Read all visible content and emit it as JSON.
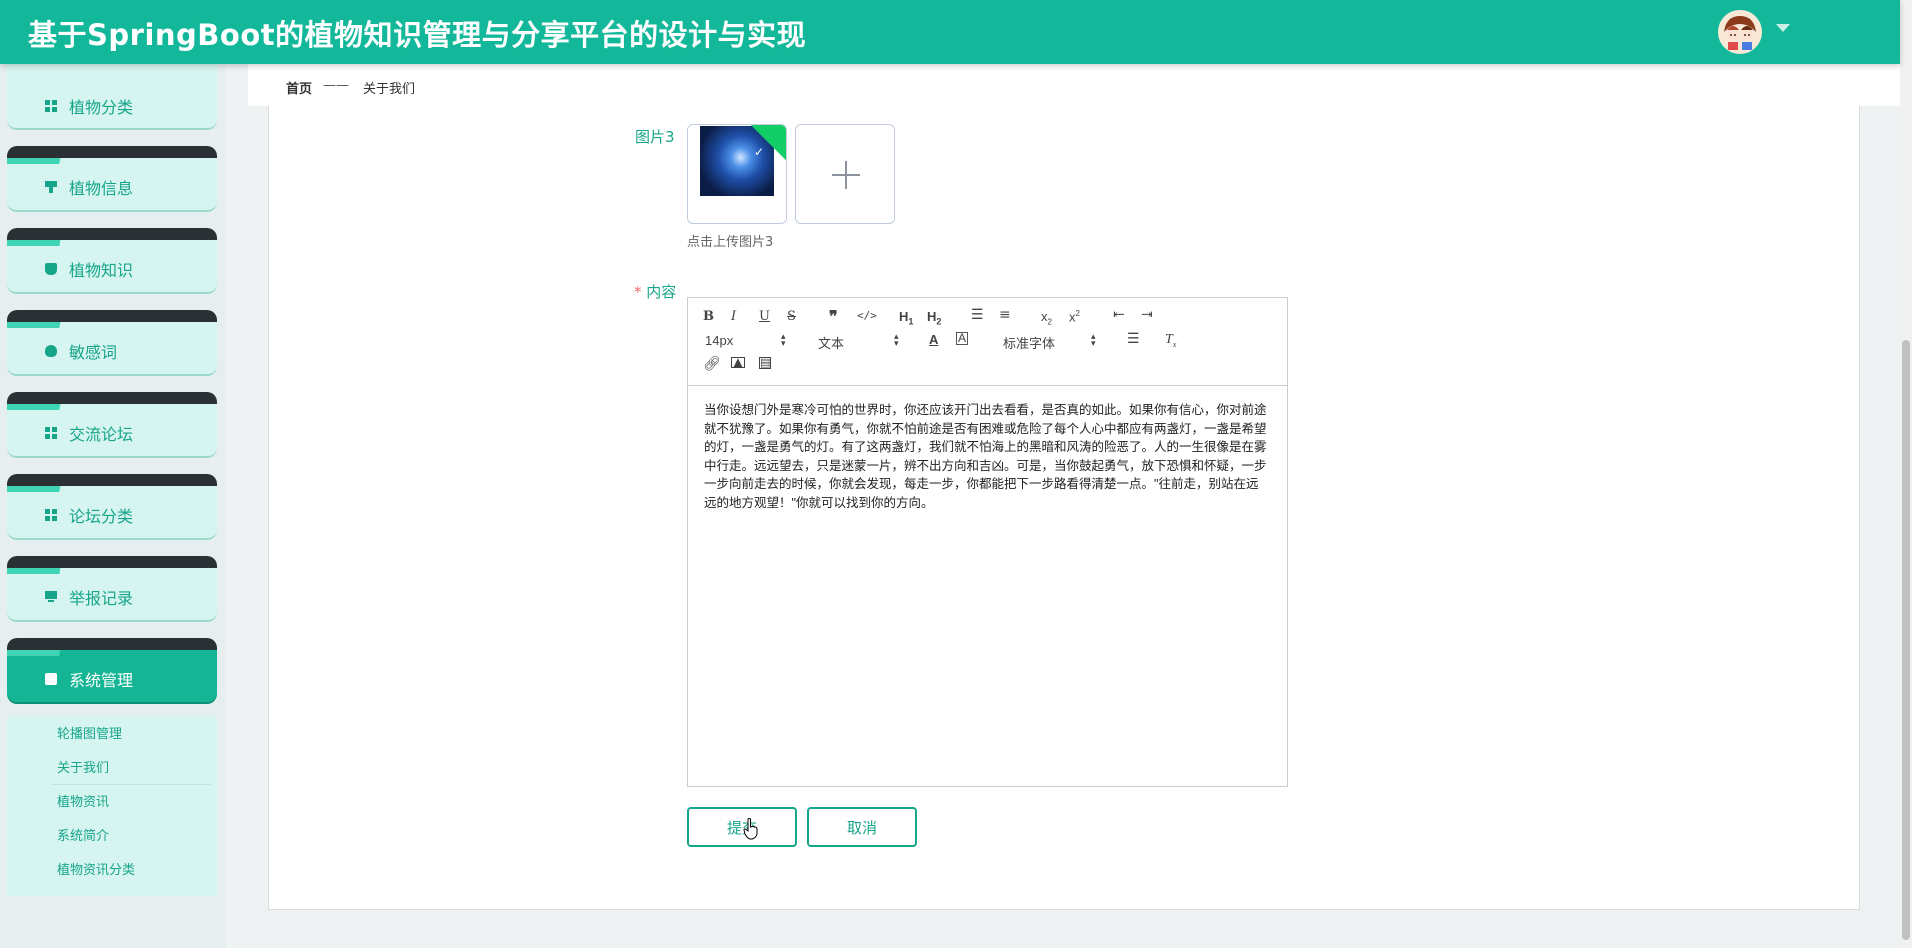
{
  "header": {
    "title": "基于SpringBoot的植物知识管理与分享平台的设计与实现"
  },
  "sidebar": {
    "items": [
      {
        "label": "植物分类",
        "icon": "grid-icon"
      },
      {
        "label": "植物信息",
        "icon": "brush-icon"
      },
      {
        "label": "植物知识",
        "icon": "cup-icon"
      },
      {
        "label": "敏感词",
        "icon": "bulb-icon"
      },
      {
        "label": "交流论坛",
        "icon": "grid-icon"
      },
      {
        "label": "论坛分类",
        "icon": "grid-icon"
      },
      {
        "label": "举报记录",
        "icon": "monitor-icon"
      },
      {
        "label": "系统管理",
        "icon": "clipboard-icon"
      }
    ],
    "submenu": [
      "轮播图管理",
      "关于我们",
      "植物资讯",
      "系统简介",
      "植物资讯分类"
    ]
  },
  "breadcrumb": {
    "home": "首页",
    "separator": "——",
    "current": "关于我们"
  },
  "form": {
    "image3_label": "图片3",
    "upload_hint": "点击上传图片3",
    "required_mark": "*",
    "content_label": "内容",
    "editor": {
      "font_size": "14px",
      "paragraph": "文本",
      "font_family": "标准字体",
      "content": "当你设想门外是寒冷可怕的世界时，你还应该开门出去看看，是否真的如此。如果你有信心，你对前途就不犹豫了。如果你有勇气，你就不怕前途是否有困难或危险了每个人心中都应有两盏灯，一盏是希望的灯，一盏是勇气的灯。有了这两盏灯，我们就不怕海上的黑暗和风涛的险恶了。人的一生很像是在雾中行走。远远望去，只是迷蒙一片，辨不出方向和吉凶。可是，当你鼓起勇气，放下恐惧和怀疑，一步一步向前走去的时候，你就会发现，每走一步，你都能把下一步路看得清楚一点。\"往前走，别站在远远的地方观望！\"你就可以找到你的方向。"
    },
    "submit_label": "提交",
    "cancel_label": "取消"
  },
  "colors": {
    "primary": "#13b89a",
    "accent_text": "#17a58a",
    "required": "#f56c6c"
  }
}
